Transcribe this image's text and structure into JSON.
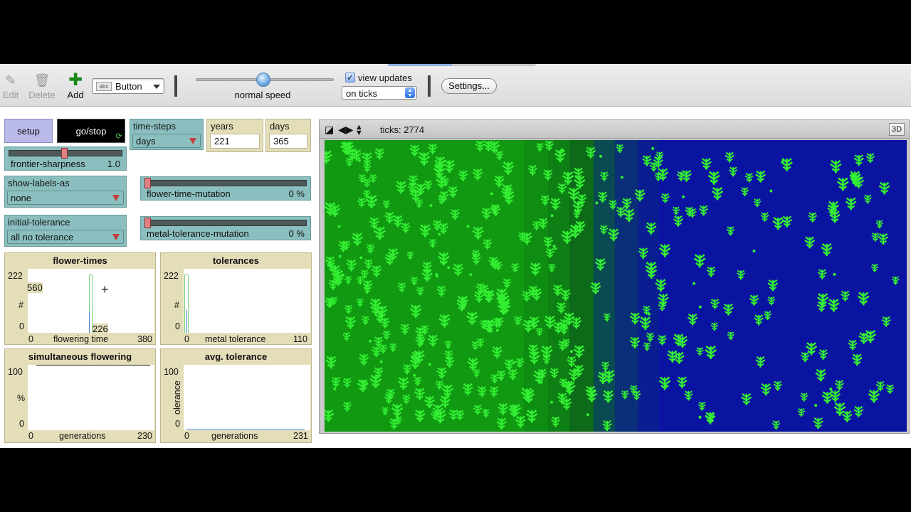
{
  "toolbar": {
    "edit_label": "Edit",
    "delete_label": "Delete",
    "add_label": "Add",
    "widget_type": "Button",
    "speed_label": "normal speed",
    "speed_value": 0.49,
    "view_updates_label": "view updates",
    "view_updates_checked": true,
    "update_mode": "on ticks",
    "settings_label": "Settings..."
  },
  "interface": {
    "setup_label": "setup",
    "go_label": "go/stop",
    "time_steps": {
      "label": "time-steps",
      "value": "days"
    },
    "years": {
      "label": "years",
      "value": "221"
    },
    "days": {
      "label": "days",
      "value": "365"
    },
    "frontier_sharpness": {
      "label": "frontier-sharpness",
      "value": "1.0",
      "position": 0.5
    },
    "show_labels_as": {
      "label": "show-labels-as",
      "value": "none"
    },
    "flower_time_mutation": {
      "label": "flower-time-mutation",
      "value": "0 %",
      "position": 0
    },
    "initial_tolerance": {
      "label": "initial-tolerance",
      "value": "all no tolerance"
    },
    "metal_tolerance_mutation": {
      "label": "metal-tolerance-mutation",
      "value": "0 %",
      "position": 0
    }
  },
  "plots": {
    "flower_times": {
      "title": "flower-times",
      "ymax": "222",
      "ymin": "0",
      "ylabel": "#",
      "xmin": "0",
      "xmax": "380",
      "xlabel": "flowering time",
      "tag_a": "560",
      "tag_b": "226"
    },
    "tolerances": {
      "title": "tolerances",
      "ymax": "222",
      "ymin": "0",
      "ylabel": "#",
      "xmin": "0",
      "xmax": "110",
      "xlabel": "metal tolerance"
    },
    "simultaneous_flowering": {
      "title": "simultaneous flowering",
      "ymax": "100",
      "ymin": "0",
      "ylabel": "%",
      "xmin": "0",
      "xmax": "230",
      "xlabel": "generations"
    },
    "avg_tolerance": {
      "title": "avg. tolerance",
      "ymax": "100",
      "ymin": "0",
      "ylabel": "olerance",
      "xmin": "0",
      "xmax": "231",
      "xlabel": "generations"
    }
  },
  "view": {
    "ticks_label": "ticks: 2774",
    "btn_3d": "3D"
  },
  "colors": {
    "grass": "#119911",
    "water": "#0a14a0",
    "plant": "#33ee33"
  }
}
